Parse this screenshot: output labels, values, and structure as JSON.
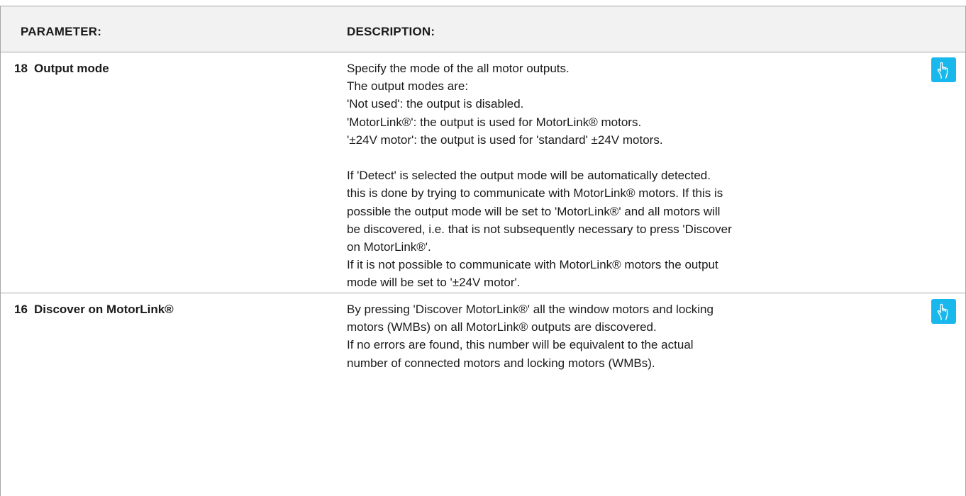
{
  "table": {
    "headers": {
      "parameter": "PARAMETER:",
      "description": "DESCRIPTION:"
    },
    "rows": [
      {
        "number": "18",
        "name": "Output mode",
        "action_icon": "hand-pointer-icon",
        "description": [
          "Specify the mode of the all motor outputs.",
          "The output modes are:",
          "'Not used': the output is disabled.",
          "'MotorLink®': the output is used for MotorLink® motors.",
          "'±24V motor': the output is used for 'standard' ±24V motors.",
          "",
          "If 'Detect' is selected the output mode will be automatically detected.",
          "this is done by trying to communicate with MotorLink® motors. If this is",
          "possible the output mode will be set to 'MotorLink®' and all motors will",
          "be discovered, i.e. that is not subsequently necessary to press 'Discover",
          "on MotorLink®'.",
          "If it is not possible to communicate with MotorLink® motors the output",
          "mode will be set to '±24V motor'."
        ]
      },
      {
        "number": "16",
        "name": "Discover on MotorLink®",
        "action_icon": "hand-pointer-icon",
        "description": [
          "By pressing 'Discover MotorLink®' all the window motors and locking",
          "motors (WMBs) on all MotorLink® outputs are discovered.",
          "If no errors are found, this number will be equivalent to the actual",
          "number of connected motors and locking motors (WMBs)."
        ]
      }
    ]
  },
  "colors": {
    "header_background": "#f2f2f2",
    "border": "#a6a6a6",
    "action_button": "#18b8ec"
  }
}
